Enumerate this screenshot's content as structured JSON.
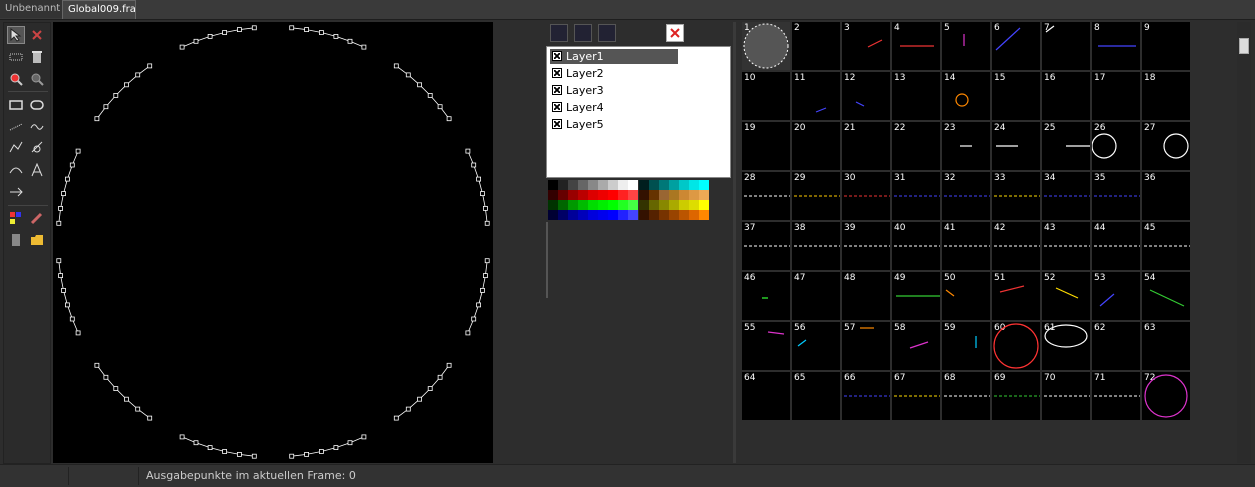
{
  "tabs": [
    {
      "label": "Unbenannt"
    },
    {
      "label": "Global009.fra"
    }
  ],
  "layers": [
    {
      "label": "Layer1"
    },
    {
      "label": "Layer2"
    },
    {
      "label": "Layer3"
    },
    {
      "label": "Layer4"
    },
    {
      "label": "Layer5"
    }
  ],
  "frames": [
    "1",
    "2",
    "3",
    "4",
    "5",
    "6",
    "7",
    "8",
    "9",
    "10",
    "11",
    "12",
    "13",
    "14",
    "15",
    "16",
    "17",
    "18",
    "19",
    "20",
    "21",
    "22",
    "23",
    "24",
    "25",
    "26",
    "27",
    "28",
    "29",
    "30",
    "31",
    "32",
    "33",
    "34",
    "35",
    "36",
    "37",
    "38",
    "39",
    "40",
    "41",
    "42",
    "43",
    "44",
    "45",
    "46",
    "47",
    "48",
    "49",
    "50",
    "51",
    "52",
    "53",
    "54",
    "55",
    "56",
    "57",
    "58",
    "59",
    "60",
    "61",
    "62",
    "63",
    "64",
    "65",
    "66",
    "67",
    "68",
    "69",
    "70",
    "71",
    "72"
  ],
  "status": {
    "text": "Ausgabepunkte im aktuellen Frame: 0"
  },
  "colors": {
    "accent": "#555555",
    "canvas": "#000000",
    "panel": "#2d2d2d"
  },
  "tools": [
    "select-arrow-icon",
    "delete-icon",
    "dotted-select-icon",
    "trash-icon",
    "zoom-in-icon",
    "zoom-out-icon",
    "rectangle-icon",
    "ellipse-icon",
    "line-icon",
    "wave-icon",
    "polyline-icon",
    "curve-icon",
    "bezier-icon",
    "text-icon",
    "move-icon",
    "color-picker-icon",
    "pencil-icon",
    "page-icon",
    "folder-icon"
  ]
}
